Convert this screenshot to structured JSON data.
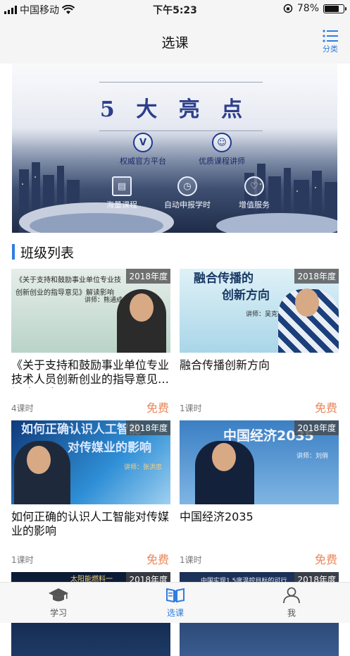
{
  "status_bar": {
    "carrier": "中国移动",
    "time": "下午5:23",
    "battery": "78%",
    "battery_level": 0.78
  },
  "navbar": {
    "title": "选课",
    "category_label": "分类"
  },
  "banner": {
    "headline": "5 大 亮 点",
    "features": [
      "权威官方平台",
      "优质课程讲师",
      "海量课程",
      "自动申报学时",
      "增值服务"
    ]
  },
  "section": {
    "title": "班级列表"
  },
  "courses": [
    {
      "year": "2018年度",
      "thumb_text_1": "《关于支持和鼓励事业单位专业技",
      "thumb_text_2": "创新创业的指导意见》解读影响",
      "thumb_teacher": "讲师：熊通成",
      "name": "《关于支持和鼓励事业单位专业技术人员创新创业的指导意见》解读影响",
      "lessons": "4课时",
      "price": "免费"
    },
    {
      "year": "2018年度",
      "thumb_text_1": "融合传播的",
      "thumb_text_2": "创新方向",
      "thumb_teacher": "讲师：吴克宇",
      "name": "融合传播创新方向",
      "lessons": "1课时",
      "price": "免费"
    },
    {
      "year": "2018年度",
      "thumb_text_1": "如何正确认识人工智能",
      "thumb_text_2": "对传媒业的影响",
      "thumb_teacher": "讲师：张洪忠",
      "name": "如何正确的认识人工智能对传媒业的影响",
      "lessons": "1课时",
      "price": "免费"
    },
    {
      "year": "2018年度",
      "thumb_text_1": "中国经济2035",
      "thumb_text_2": "",
      "thumb_teacher": "讲师：刘俏",
      "name": "中国经济2035",
      "lessons": "1课时",
      "price": "免费"
    },
    {
      "year": "2018年度",
      "thumb_text_1": "太阳能燃料一",
      "name": ""
    },
    {
      "year": "2018年度",
      "thumb_text_1": "中国实现1.5度温控目标的可行",
      "name": ""
    }
  ],
  "tabbar": {
    "tabs": [
      {
        "label": "学习"
      },
      {
        "label": "选课"
      },
      {
        "label": "我"
      }
    ]
  },
  "colors": {
    "accent": "#2f7de1",
    "price": "#e9865a"
  }
}
